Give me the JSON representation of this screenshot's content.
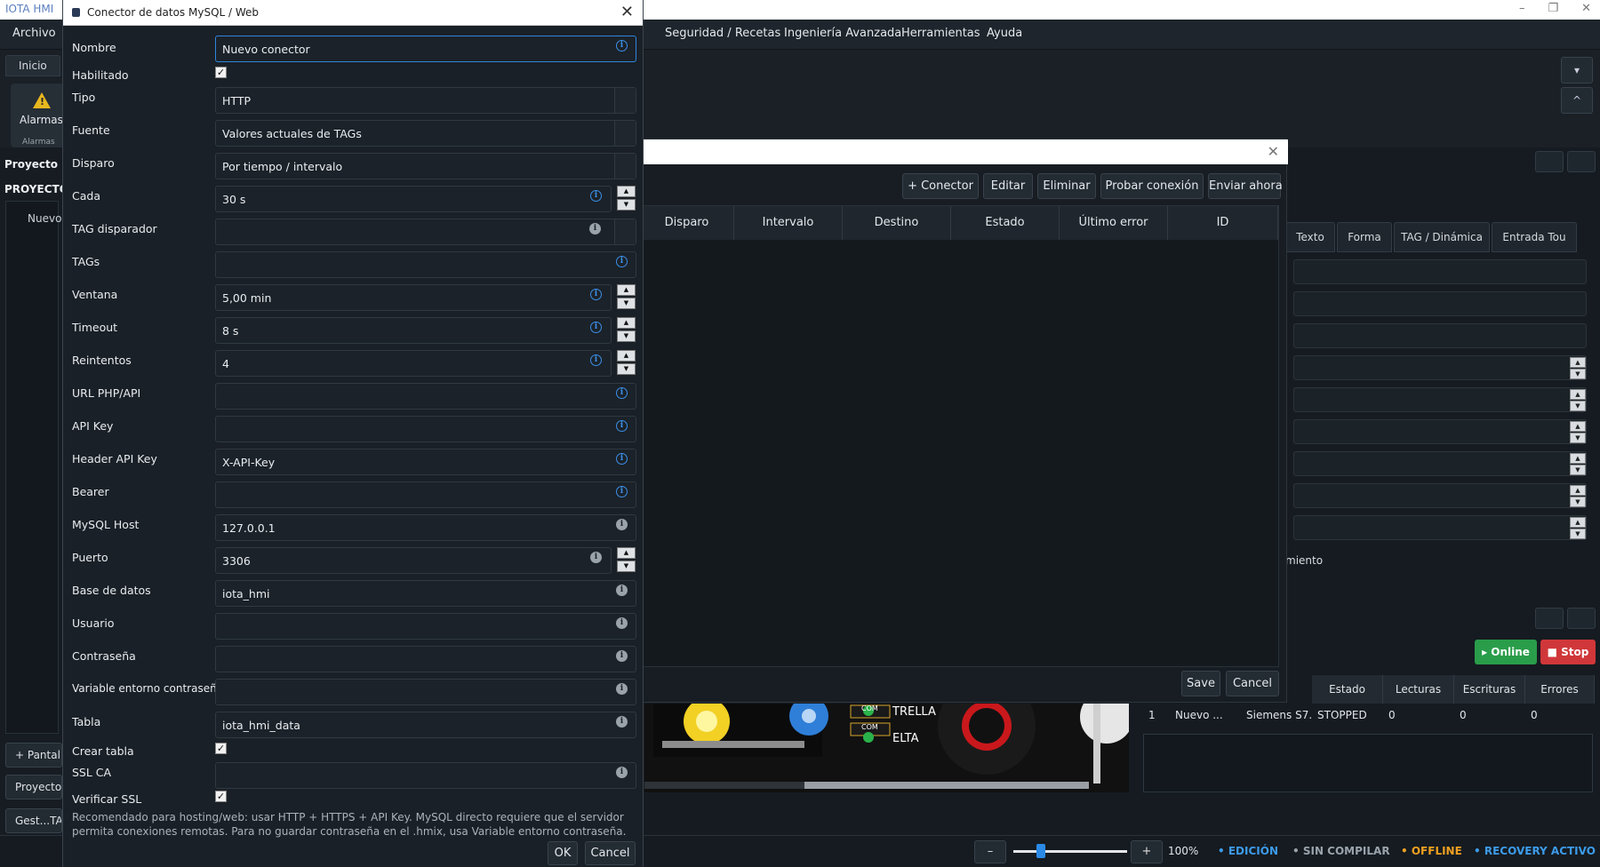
{
  "app": {
    "title": "IOTA HMI",
    "window_controls": [
      "–",
      "❐",
      "✕"
    ]
  },
  "menu": [
    "Archivo",
    "Seguridad / Recetas",
    "Ingeniería Avanzada",
    "Herramientas",
    "Ayuda"
  ],
  "ribbon": {
    "tab": "Inicio",
    "alarm_button": "Alarmas",
    "alarm_caption": "Alarmas",
    "collapse_up": "^",
    "dropdown": "▾"
  },
  "left_panel": {
    "section": "Proyecto",
    "tree_header": "PROYECTO",
    "tree_item": "Nuevo",
    "add_screen": "+ Pantall",
    "bottom_tab_1": "Proyecto",
    "bottom_tab_2": "Gest...TAG"
  },
  "connector_dialog": {
    "title": "Conector de datos MySQL / Web",
    "fields": {
      "nombre": {
        "label": "Nombre",
        "value": "Nuevo conector"
      },
      "habilitado": {
        "label": "Habilitado",
        "checked": true
      },
      "tipo": {
        "label": "Tipo",
        "value": "HTTP"
      },
      "fuente": {
        "label": "Fuente",
        "value": "Valores actuales de TAGs"
      },
      "disparo": {
        "label": "Disparo",
        "value": "Por tiempo / intervalo"
      },
      "cada": {
        "label": "Cada",
        "value": "30 s"
      },
      "tag_disparador": {
        "label": "TAG disparador",
        "value": ""
      },
      "tags": {
        "label": "TAGs",
        "value": ""
      },
      "ventana": {
        "label": "Ventana",
        "value": "5,00 min"
      },
      "timeout": {
        "label": "Timeout",
        "value": "8 s"
      },
      "reintentos": {
        "label": "Reintentos",
        "value": "4"
      },
      "url": {
        "label": "URL PHP/API",
        "value": ""
      },
      "api_key": {
        "label": "API Key",
        "value": ""
      },
      "header_api_key": {
        "label": "Header API Key",
        "value": "X-API-Key"
      },
      "bearer": {
        "label": "Bearer",
        "value": ""
      },
      "mysql_host": {
        "label": "MySQL Host",
        "value": "127.0.0.1"
      },
      "puerto": {
        "label": "Puerto",
        "value": "3306"
      },
      "base_datos": {
        "label": "Base de datos",
        "value": "iota_hmi"
      },
      "usuario": {
        "label": "Usuario",
        "value": ""
      },
      "contrasena": {
        "label": "Contraseña",
        "value": ""
      },
      "var_entorno": {
        "label": "Variable entorno contraseña",
        "value": ""
      },
      "tabla": {
        "label": "Tabla",
        "value": "iota_hmi_data"
      },
      "crear_tabla": {
        "label": "Crear tabla",
        "checked": true
      },
      "ssl_ca": {
        "label": "SSL CA",
        "value": ""
      },
      "verificar_ssl": {
        "label": "Verificar SSL",
        "checked": true
      }
    },
    "hint": "Recomendado para hosting/web: usar HTTP + HTTPS + API Key. MySQL directo requiere que el servidor permita conexiones remotas. Para no guardar contraseña en el .hmix, usa Variable entorno contraseña.",
    "ok_label": "OK",
    "cancel_label": "Cancel"
  },
  "list_dialog": {
    "buttons": [
      "+ Conector",
      "Editar",
      "Eliminar",
      "Probar conexión",
      "Enviar ahora"
    ],
    "columns": [
      "Disparo",
      "Intervalo",
      "Destino",
      "Estado",
      "Último error",
      "ID"
    ],
    "save_label": "Save",
    "cancel_label": "Cancel"
  },
  "properties": {
    "tabs": [
      "Texto",
      "Forma",
      "TAG / Dinámica",
      "Entrada Tou"
    ],
    "fragment": "miento"
  },
  "canvas_labels": {
    "com1": "COM",
    "com2": "COM",
    "l1": "TRELLA",
    "l2": "ELTA"
  },
  "drivers": {
    "online_label": "▸ Online",
    "stop_label": "■ Stop",
    "columns": [
      "Estado",
      "Lecturas",
      "Escrituras",
      "Errores"
    ],
    "row": [
      "1",
      "Nuevo ...",
      "Siemens S7...",
      "STOPPED",
      "0",
      "0",
      "0"
    ]
  },
  "statusbar": {
    "zoom_minus": "–",
    "zoom_plus": "+",
    "zoom": "100%",
    "edicion": "• EDICIÓN",
    "sin_compilar": "• SIN COMPILAR",
    "offline": "• OFFLINE",
    "recovery": "• RECOVERY ACTIVO",
    "colors": {
      "edicion": "#3d9be9",
      "sin_compilar": "#9aa3ab",
      "offline": "#f0a020",
      "recovery": "#3d9be9"
    }
  }
}
